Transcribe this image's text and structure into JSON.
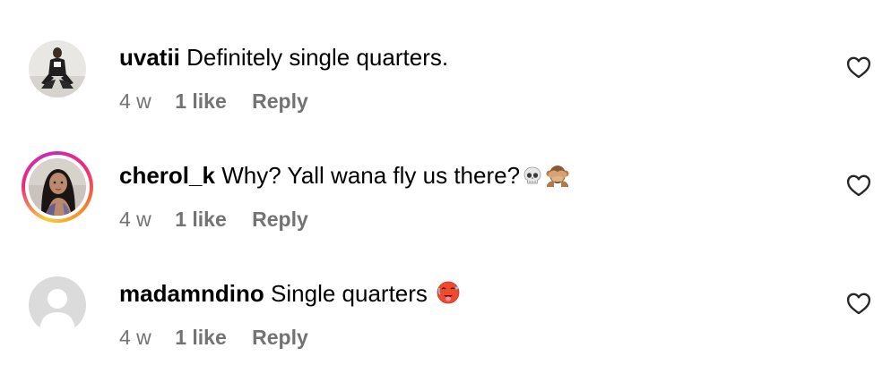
{
  "comments": [
    {
      "username": "uvatii",
      "text": "Definitely single quarters.",
      "time": "4 w",
      "likes": "1 like",
      "reply_label": "Reply",
      "has_story_ring": false,
      "avatar": "profile-photo",
      "emojis": []
    },
    {
      "username": "cherol_k",
      "text": "Why? Yall wana fly us there?",
      "time": "4 w",
      "likes": "1 like",
      "reply_label": "Reply",
      "has_story_ring": true,
      "avatar": "profile-photo",
      "emojis": [
        "skull",
        "see-no-evil-monkey"
      ]
    },
    {
      "username": "madamndino",
      "text": "Single quarters",
      "time": "4 w",
      "likes": "1 like",
      "reply_label": "Reply",
      "has_story_ring": false,
      "avatar": "default-avatar",
      "emojis": [
        "hot-face"
      ]
    }
  ],
  "icons": {
    "like": "heart-outline-icon"
  },
  "colors": {
    "text": "#000000",
    "meta": "#737373",
    "default_avatar_bg": "#dbdbdb",
    "story_ring": [
      "#f9ce34",
      "#ee2a7b",
      "#c92bb5"
    ]
  }
}
